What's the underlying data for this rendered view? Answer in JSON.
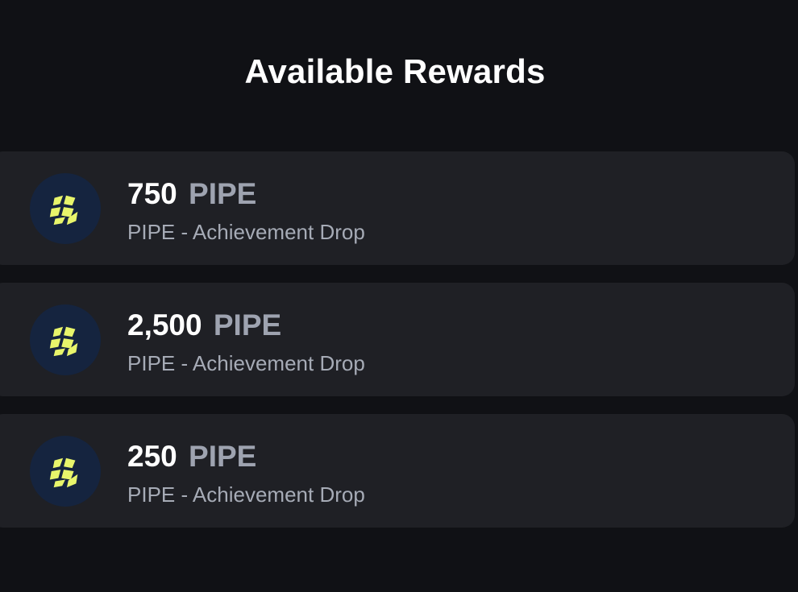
{
  "page": {
    "title": "Available Rewards"
  },
  "rewards": [
    {
      "amount": "750",
      "unit": "PIPE",
      "description": "PIPE - Achievement Drop",
      "icon": "pipe-token-icon"
    },
    {
      "amount": "2,500",
      "unit": "PIPE",
      "description": "PIPE - Achievement Drop",
      "icon": "pipe-token-icon"
    },
    {
      "amount": "250",
      "unit": "PIPE",
      "description": "PIPE - Achievement Drop",
      "icon": "pipe-token-icon"
    }
  ],
  "colors": {
    "background": "#101115",
    "card": "#1f2025",
    "icon_bg": "#15243f",
    "icon_fg": "#e8f56b",
    "unit_text": "#9ea3b0"
  }
}
